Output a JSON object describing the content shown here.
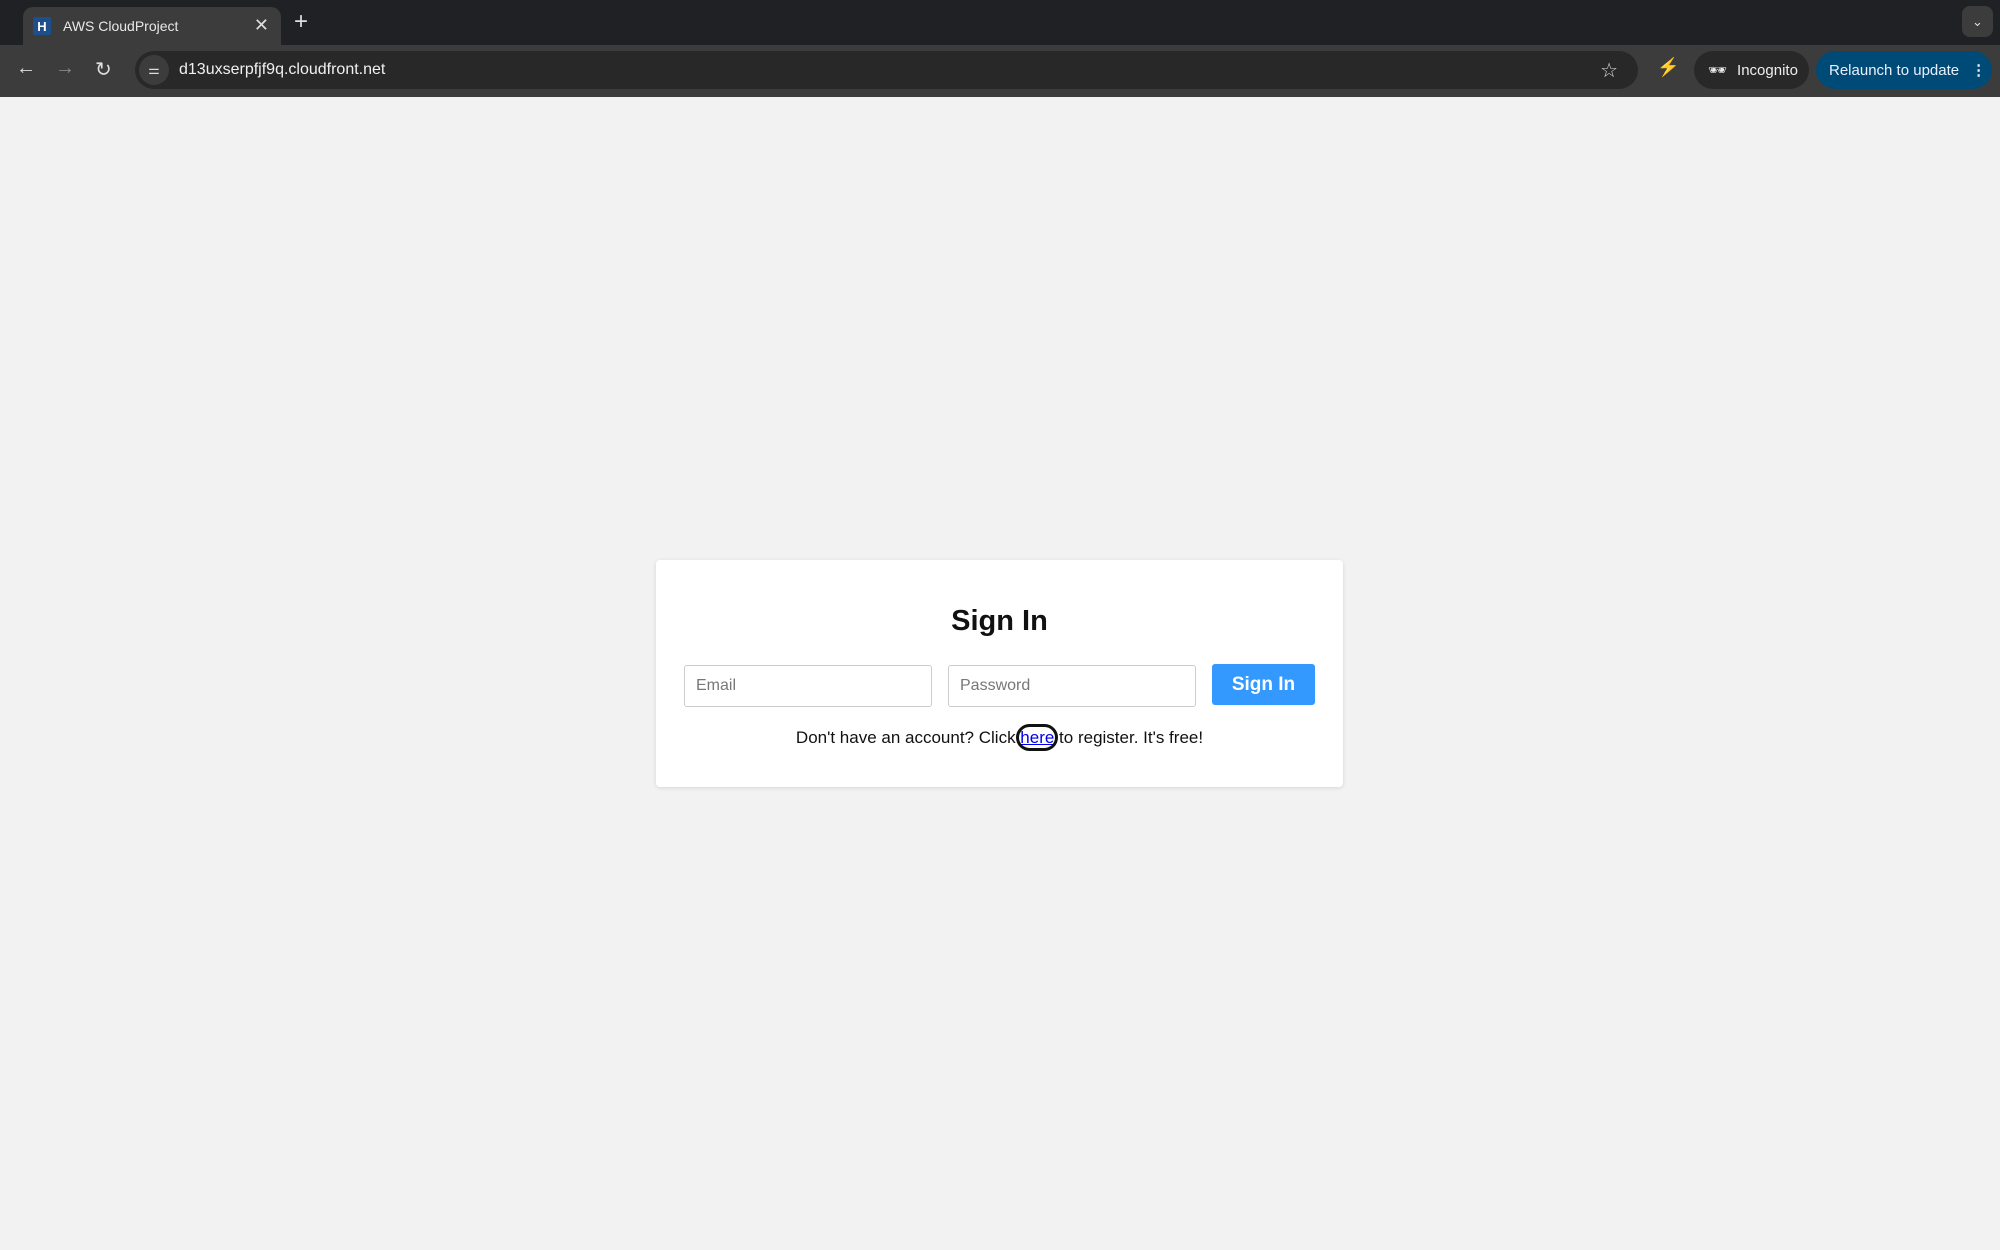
{
  "browser": {
    "tab_title": "AWS CloudProject",
    "favicon_letter": "H",
    "url": "d13uxserpfjf9q.cloudfront.net",
    "incognito_label": "Incognito",
    "relaunch_label": "Relaunch to update"
  },
  "signin": {
    "title": "Sign In",
    "email_placeholder": "Email",
    "password_placeholder": "Password",
    "button_label": "Sign In",
    "register_prefix": "Don't have an account? Click ",
    "register_link": "here",
    "register_suffix": " to register. It's free!"
  },
  "colors": {
    "button": "#3399ff",
    "relaunch": "#004a77",
    "background": "#f2f2f2"
  }
}
